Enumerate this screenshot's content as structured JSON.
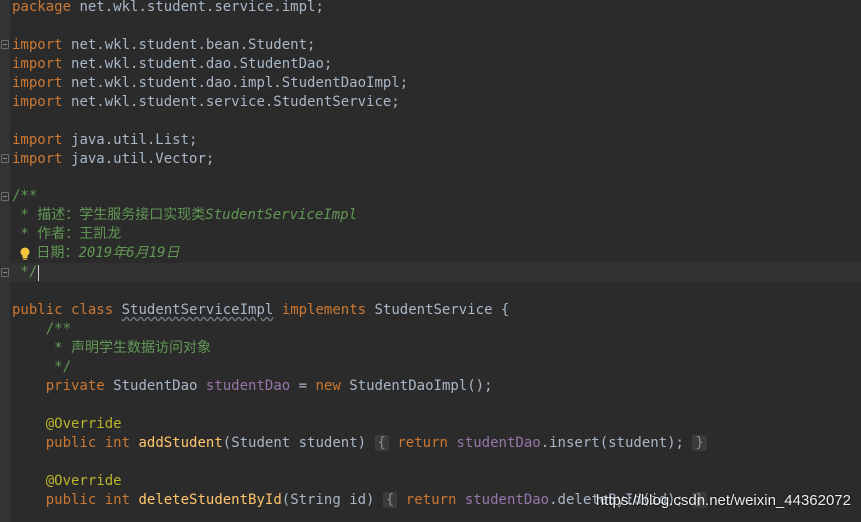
{
  "code": {
    "package_kw": "package",
    "package_name": "net.wkl.student.service.impl;",
    "imports": [
      {
        "kw": "import",
        "name": "net.wkl.student.bean.Student;"
      },
      {
        "kw": "import",
        "name": "net.wkl.student.dao.StudentDao;"
      },
      {
        "kw": "import",
        "name": "net.wkl.student.dao.impl.StudentDaoImpl;"
      },
      {
        "kw": "import",
        "name": "net.wkl.student.service.StudentService;"
      },
      {
        "kw": "import",
        "name": "java.util.List;"
      },
      {
        "kw": "import",
        "name": "java.util.Vector;"
      }
    ],
    "doc_open": "/**",
    "doc_desc_prefix": " * 描述：学生服务接口实现类",
    "doc_desc_class": "StudentServiceImpl",
    "doc_author": " * 作者：王凯龙",
    "doc_date_prefix": " 日期：",
    "doc_date_value": "2019年6月19日",
    "doc_close": " */",
    "class_public": "public",
    "class_kw": "class",
    "class_name": "StudentServiceImpl",
    "class_implements": "implements",
    "class_iface": "StudentService {",
    "field_doc_open": "    /**",
    "field_doc_text": "     * 声明学生数据访问对象",
    "field_doc_close": "     */",
    "field_private": "    private",
    "field_type": "StudentDao",
    "field_name": "studentDao",
    "field_eq": "=",
    "field_new": "new",
    "field_init": "StudentDaoImpl();",
    "override": "    @Override",
    "m1_public": "    public",
    "m1_int": "int",
    "m1_name": "addStudent",
    "m1_params": "(Student student)",
    "m1_open": "{",
    "m1_return": "return",
    "m1_field": "studentDao",
    "m1_call": ".insert(student);",
    "m1_close": "}",
    "override2": "    @Override",
    "m2_public": "    public",
    "m2_int": "int",
    "m2_name": "deleteStudentById",
    "m2_params": "(String id)",
    "m2_open": "{",
    "m2_return": "return",
    "m2_field": "studentDao",
    "m2_call": ".deleteById(id);",
    "m2_close": "}"
  },
  "watermark": "https://blog.csdn.net/weixin_44362072",
  "colors": {
    "background": "#2b2b2b",
    "keyword": "#cc7832",
    "comment": "#629755",
    "annotation": "#bbb529",
    "field": "#9876aa",
    "method": "#ffc66d",
    "text": "#a9b7c6"
  },
  "icons": {
    "intention": "lightbulb-icon",
    "fold": "fold-marker-icon"
  }
}
